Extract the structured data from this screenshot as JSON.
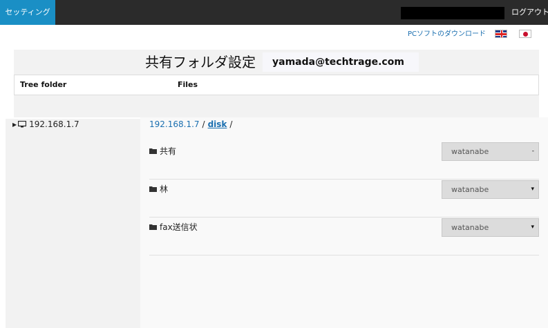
{
  "topbar": {
    "tab_label": "セッティング",
    "logout_label": "ログアウト"
  },
  "utility": {
    "download_link": "PCソフトのダウンロード"
  },
  "header": {
    "title": "共有フォルダ設定",
    "user_email": "yamada@techtrage.com"
  },
  "columns": {
    "tree": "Tree folder",
    "files": "Files"
  },
  "tree": {
    "node_label": "192.168.1.7"
  },
  "breadcrumb": {
    "host": "192.168.1.7",
    "sep1": "/",
    "folder": "disk",
    "sep2": "/"
  },
  "folders": [
    {
      "name": "共有",
      "owner": "watanabe",
      "arrow": "-"
    },
    {
      "name": "林",
      "owner": "watanabe",
      "arrow": "▾"
    },
    {
      "name": "fax送信状",
      "owner": "watanabe",
      "arrow": "▾"
    }
  ],
  "colors": {
    "topbar": "#2b2b2b",
    "tab_active": "#1a8fc5",
    "link": "#1a6fb0",
    "panel_bg": "#f2f2f2"
  }
}
